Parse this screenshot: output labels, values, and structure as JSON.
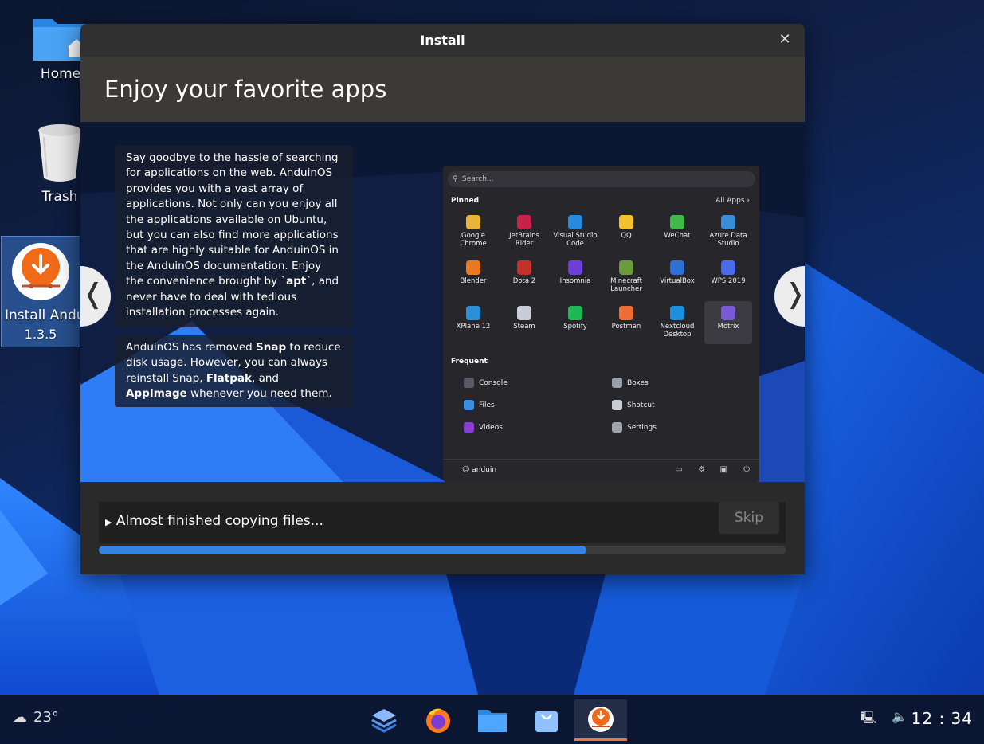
{
  "desktop": {
    "icons": [
      {
        "label": "Home"
      },
      {
        "label": "Trash"
      },
      {
        "label_line1": "Install Andu",
        "label_line2": "1.3.5"
      }
    ]
  },
  "dialog": {
    "title": "Install",
    "close_glyph": "✕",
    "heading": "Enjoy your favorite apps",
    "prev_glyph": "❬",
    "next_glyph": "❭",
    "text1": {
      "a": "Say goodbye to the hassle of searching for applications on the web. AnduinOS provides you with a vast array of applications. Not only can you enjoy all the applications available on Ubuntu, but you can also find more applications that are highly suitable for AnduinOS in the AnduinOS documentation. Enjoy the convenience brought by ",
      "b": "`apt`",
      "c": ", and never have to deal with tedious installation processes again."
    },
    "text2": {
      "a": "AnduinOS has removed ",
      "snap": "Snap",
      "b": " to reduce disk usage. However, you can always reinstall Snap, ",
      "flatpak": "Flatpak",
      "c": ", and ",
      "appimage": "AppImage",
      "d": " whenever you need them."
    },
    "menu": {
      "search_placeholder": "Search...",
      "pinned_label": "Pinned",
      "all_apps_label": "All Apps  ›",
      "apps": [
        {
          "line1": "Google",
          "line2": "Chrome",
          "color": "#e8b53a"
        },
        {
          "line1": "JetBrains",
          "line2": "Rider",
          "color": "#c6234b"
        },
        {
          "line1": "Visual Studio",
          "line2": "Code",
          "color": "#2a8ae0"
        },
        {
          "line1": "QQ",
          "line2": "",
          "color": "#f2c230"
        },
        {
          "line1": "WeChat",
          "line2": "",
          "color": "#3fb94a"
        },
        {
          "line1": "Azure Data",
          "line2": "Studio",
          "color": "#3a8ed8"
        },
        {
          "line1": "Blender",
          "line2": "",
          "color": "#ea7a1f"
        },
        {
          "line1": "Dota 2",
          "line2": "",
          "color": "#c3312a"
        },
        {
          "line1": "Insomnia",
          "line2": "",
          "color": "#6d3ed8"
        },
        {
          "line1": "Minecraft",
          "line2": "Launcher",
          "color": "#6c9a3a"
        },
        {
          "line1": "VirtualBox",
          "line2": "",
          "color": "#2e6fd3"
        },
        {
          "line1": "WPS 2019",
          "line2": "",
          "color": "#4a6bea"
        },
        {
          "line1": "XPlane 12",
          "line2": "",
          "color": "#2b8fd6"
        },
        {
          "line1": "Steam",
          "line2": "",
          "color": "#c9ced6"
        },
        {
          "line1": "Spotify",
          "line2": "",
          "color": "#1db954"
        },
        {
          "line1": "Postman",
          "line2": "",
          "color": "#ef6c35"
        },
        {
          "line1": "Nextcloud",
          "line2": "Desktop",
          "color": "#1d8fe0"
        },
        {
          "line1": "Motrix",
          "line2": "",
          "color": "#7b5ad8"
        }
      ],
      "frequent_label": "Frequent",
      "frequent": [
        {
          "label": "Console",
          "color": "#5a5a66"
        },
        {
          "label": "Boxes",
          "color": "#9aa0a8"
        },
        {
          "label": "Files",
          "color": "#3b8ede"
        },
        {
          "label": "Shotcut",
          "color": "#c8cdd4"
        },
        {
          "label": "Videos",
          "color": "#8a3cd8"
        },
        {
          "label": "Settings",
          "color": "#a0a4ac"
        }
      ],
      "user": "anduin"
    },
    "status": "Almost finished copying files...",
    "skip_label": "Skip",
    "progress": 0.71
  },
  "taskbar": {
    "weather": "23°",
    "clock": "12 : 34",
    "apps": [
      "task-view",
      "firefox",
      "files",
      "store",
      "installer"
    ],
    "active_app": "installer"
  }
}
